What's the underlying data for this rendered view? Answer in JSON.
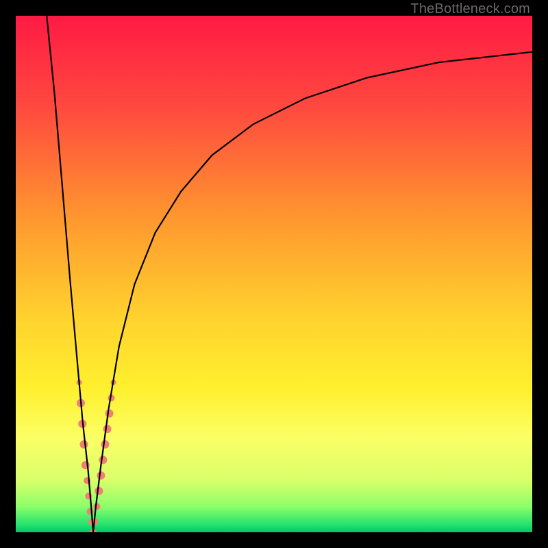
{
  "watermark": "TheBottleneck.com",
  "chart_data": {
    "type": "line",
    "title": "",
    "xlabel": "",
    "ylabel": "",
    "xlim": [
      0,
      100
    ],
    "ylim": [
      0,
      100
    ],
    "grid": false,
    "legend": false,
    "notes": "Bottleneck chart: black V-curve with minimum near x≈15 over a vertical red→orange→yellow→green gradient. Salmon dotted markers cluster near the minimum on both branches.",
    "colors": {
      "gradient_stops": [
        {
          "offset": 0.0,
          "hex": "#ff1a44"
        },
        {
          "offset": 0.18,
          "hex": "#ff4a3e"
        },
        {
          "offset": 0.4,
          "hex": "#ff9a2e"
        },
        {
          "offset": 0.58,
          "hex": "#ffd12e"
        },
        {
          "offset": 0.72,
          "hex": "#fff02e"
        },
        {
          "offset": 0.82,
          "hex": "#fbff66"
        },
        {
          "offset": 0.9,
          "hex": "#d8ff6a"
        },
        {
          "offset": 0.95,
          "hex": "#8dff6a"
        },
        {
          "offset": 0.985,
          "hex": "#25e36e"
        },
        {
          "offset": 1.0,
          "hex": "#00c76a"
        }
      ],
      "curve": "#000000",
      "markers": "#ef7e74"
    },
    "series": [
      {
        "name": "left-branch",
        "x": [
          6.0,
          7.5,
          9.0,
          10.5,
          12.0,
          13.0,
          14.0,
          14.6,
          15.0
        ],
        "y": [
          100,
          85,
          67,
          49,
          32,
          21,
          12,
          5,
          0
        ]
      },
      {
        "name": "right-branch",
        "x": [
          15.0,
          15.5,
          16.5,
          18.0,
          20.0,
          23.0,
          27.0,
          32.0,
          38.0,
          46.0,
          56.0,
          68.0,
          82.0,
          100.0
        ],
        "y": [
          0,
          5,
          13,
          24,
          36,
          48,
          58,
          66,
          73,
          79,
          84,
          88,
          91,
          93
        ]
      }
    ],
    "markers": [
      {
        "branch": "left",
        "x": 12.3,
        "y": 29,
        "r": 4
      },
      {
        "branch": "left",
        "x": 12.6,
        "y": 25,
        "r": 6
      },
      {
        "branch": "left",
        "x": 12.9,
        "y": 21,
        "r": 6
      },
      {
        "branch": "left",
        "x": 13.2,
        "y": 17,
        "r": 6
      },
      {
        "branch": "left",
        "x": 13.5,
        "y": 13,
        "r": 6
      },
      {
        "branch": "left",
        "x": 13.8,
        "y": 10,
        "r": 5
      },
      {
        "branch": "left",
        "x": 14.1,
        "y": 7,
        "r": 5
      },
      {
        "branch": "left",
        "x": 14.4,
        "y": 4,
        "r": 5
      },
      {
        "branch": "left",
        "x": 14.7,
        "y": 2,
        "r": 5
      },
      {
        "branch": "left",
        "x": 15.0,
        "y": 0,
        "r": 5
      },
      {
        "branch": "right",
        "x": 15.3,
        "y": 2,
        "r": 5
      },
      {
        "branch": "right",
        "x": 15.7,
        "y": 5,
        "r": 5
      },
      {
        "branch": "right",
        "x": 16.1,
        "y": 8,
        "r": 6
      },
      {
        "branch": "right",
        "x": 16.5,
        "y": 11,
        "r": 6
      },
      {
        "branch": "right",
        "x": 16.9,
        "y": 14,
        "r": 6
      },
      {
        "branch": "right",
        "x": 17.3,
        "y": 17,
        "r": 6
      },
      {
        "branch": "right",
        "x": 17.7,
        "y": 20,
        "r": 6
      },
      {
        "branch": "right",
        "x": 18.1,
        "y": 23,
        "r": 6
      },
      {
        "branch": "right",
        "x": 18.5,
        "y": 26,
        "r": 5
      },
      {
        "branch": "right",
        "x": 18.9,
        "y": 29,
        "r": 4
      }
    ]
  }
}
